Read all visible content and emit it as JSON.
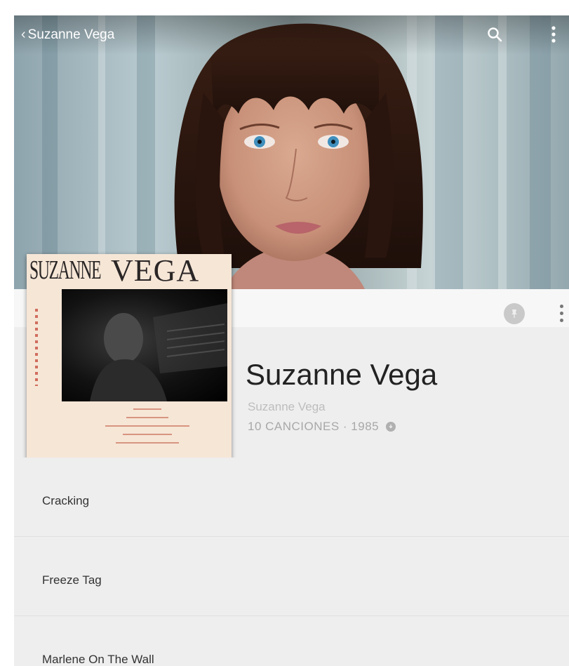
{
  "header": {
    "back_label": "Suzanne Vega"
  },
  "album": {
    "cover_text_first": "SUZANNE",
    "cover_text_last": "VEGA",
    "title": "Suzanne Vega",
    "artist": "Suzanne Vega",
    "meta": "10 CANCIONES · 1985"
  },
  "tracks": [
    {
      "title": "Cracking"
    },
    {
      "title": "Freeze Tag"
    },
    {
      "title": "Marlene On The Wall"
    }
  ],
  "icons": {
    "back": "chevron-left-icon",
    "search": "search-icon",
    "more": "more-vert-icon",
    "pin": "pin-icon",
    "download": "download-icon"
  },
  "colors": {
    "background": "#eeeeee",
    "title_text": "#222222",
    "secondary_text": "#bdbdbd"
  }
}
